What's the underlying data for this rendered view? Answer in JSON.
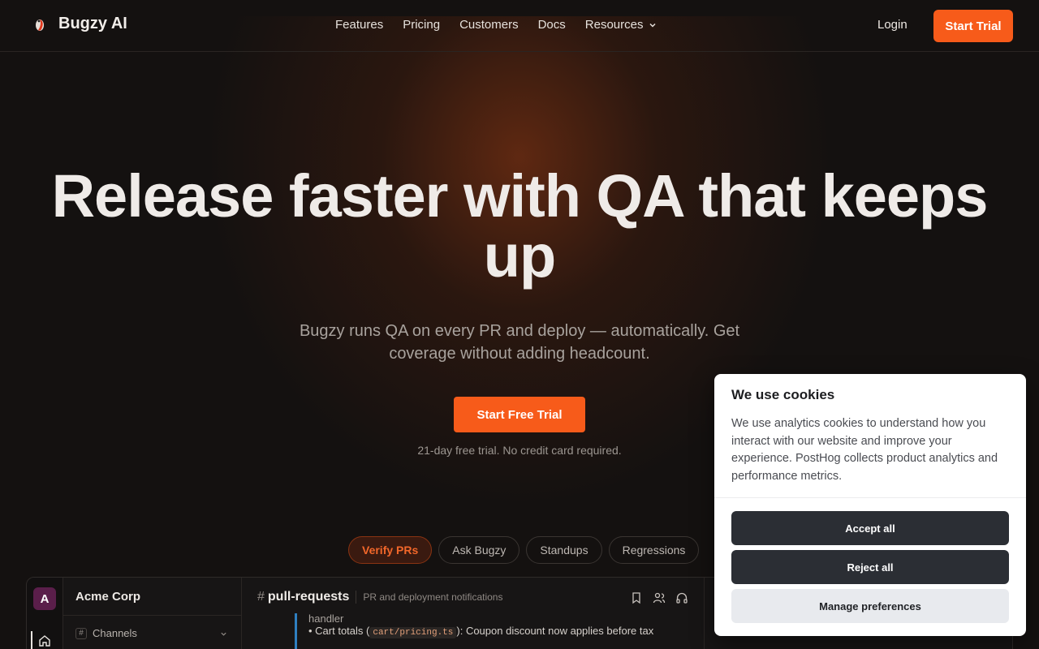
{
  "nav": {
    "brand": "Bugzy AI",
    "links": [
      "Features",
      "Pricing",
      "Customers",
      "Docs",
      "Resources"
    ],
    "login": "Login",
    "start_trial": "Start Trial"
  },
  "hero": {
    "title": "Release faster with QA that keeps up",
    "subtitle": "Bugzy runs QA on every PR and deploy — automatically. Get coverage without adding headcount.",
    "cta": "Start Free Trial",
    "note": "21-day free trial. No credit card required."
  },
  "tabs": [
    {
      "label": "Verify PRs",
      "active": true
    },
    {
      "label": "Ask Bugzy",
      "active": false
    },
    {
      "label": "Standups",
      "active": false
    },
    {
      "label": "Regressions",
      "active": false
    }
  ],
  "app_preview": {
    "workspace_initial": "A",
    "workspace_name": "Acme Corp",
    "channels_label": "Channels",
    "channel_hash": "#",
    "channel_name": "pull-requests",
    "channel_description": "PR and deployment notifications",
    "message_prefix": "handler",
    "message_bullet": "• Cart totals (",
    "message_code": "cart/pricing.ts",
    "message_rest": "): Coupon discount now applies before tax"
  },
  "cookie": {
    "title": "We use cookies",
    "text": "We use analytics cookies to understand how you interact with our website and improve your experience. PostHog collects product analytics and performance metrics.",
    "accept": "Accept all",
    "reject": "Reject all",
    "manage": "Manage preferences"
  },
  "colors": {
    "accent": "#f75b1a",
    "background": "#141110",
    "channel_bar": "#2f7fc0"
  }
}
